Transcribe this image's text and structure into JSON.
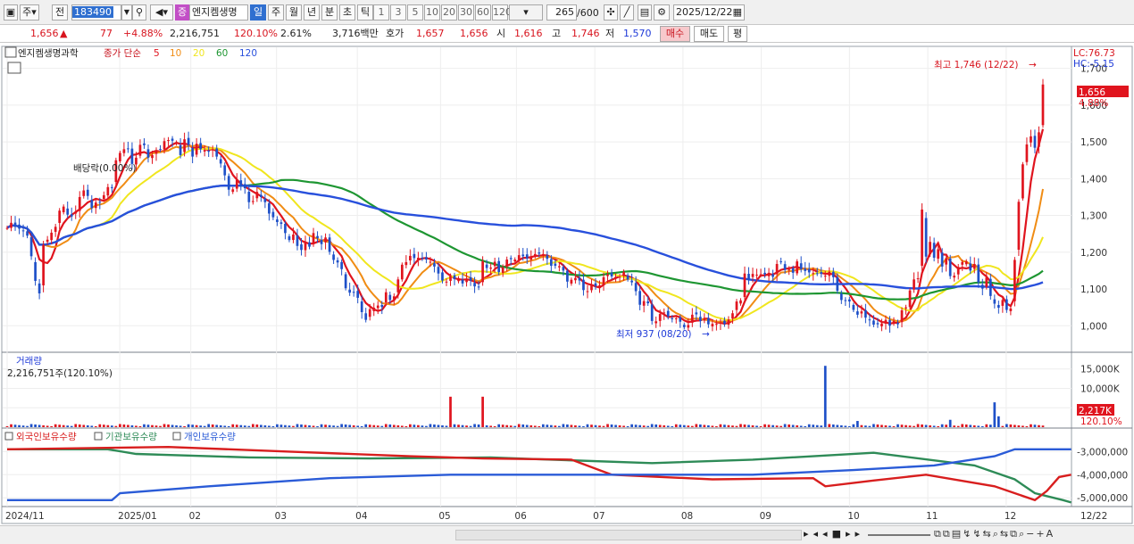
{
  "toolbar": {
    "period_label": "주",
    "prev_label": "전",
    "stock_code": "183490",
    "stock_name": "엔지켐생명",
    "name_badge": "증",
    "periods": [
      "일",
      "주",
      "월",
      "년",
      "분",
      "초",
      "틱"
    ],
    "active_period": "일",
    "intervals": [
      "1",
      "3",
      "5",
      "10",
      "20",
      "30",
      "60",
      "120"
    ],
    "count": "265",
    "count_max": "/600",
    "date": "2025/12/22"
  },
  "quote": {
    "price": "1,656",
    "change": "77",
    "change_pct": "+4.88%",
    "volume": "2,216,751",
    "volume_ratio": "120.10%",
    "turnover": "2.61%",
    "amount": "3,716백만",
    "ask_label": "호가",
    "ask": "1,657",
    "bid": "1,656",
    "open_label": "시",
    "open": "1,616",
    "high_label": "고",
    "high": "1,746",
    "low_label": "저",
    "low": "1,570",
    "buy_label": "매수",
    "sell_label": "매도",
    "eval_label": "평"
  },
  "price_panel": {
    "title": "엔지켐생명과학",
    "ma_label": "종가 단순",
    "ma_periods": [
      "5",
      "10",
      "20",
      "60",
      "120"
    ],
    "lc": "LC:76.73",
    "hc": "HC:-5.15",
    "y_labels": [
      "1,700",
      "1,600",
      "1,500",
      "1,400",
      "1,300",
      "1,200",
      "1,100",
      "1,000"
    ],
    "current_price": "1,656",
    "current_pct": "4.88%",
    "high_annot": "최고 1,746 (12/22)",
    "low_annot": "최저 937 (08/20)",
    "div_annot": "배당락(0.00%)"
  },
  "volume_panel": {
    "title": "거래량",
    "value": "2,216,751주(120.10%)",
    "y_labels": [
      "15,000K",
      "10,000K",
      "5,000K"
    ],
    "current": "2,217K",
    "current_pct": "120.10%"
  },
  "holdings_panel": {
    "legend": [
      "외국인보유수량",
      "기관보유수량",
      "개인보유수량"
    ],
    "y_labels": [
      "-3,000,000",
      "-4,000,000",
      "-5,000,000"
    ]
  },
  "x_labels": [
    "2024/11",
    "2025/01",
    "02",
    "03",
    "04",
    "05",
    "06",
    "07",
    "08",
    "09",
    "10",
    "11",
    "12",
    "12/22"
  ],
  "colors": {
    "up": "#e0141e",
    "down": "#1e50c8",
    "ma5": "#e0141e",
    "ma10": "#f08c14",
    "ma20": "#f0e61e",
    "ma60": "#1e9632",
    "ma120": "#2850dc",
    "foreign": "#d81e1e",
    "institution": "#2e8b57",
    "individual": "#2a5bd7"
  },
  "chart_data": {
    "type": "candlestick",
    "title": "엔지켐생명과학",
    "y_range": [
      940,
      1750
    ],
    "close": [
      1266,
      1280,
      1270,
      1264,
      1259,
      1245,
      1189,
      1122,
      1088,
      1220,
      1234,
      1253,
      1269,
      1313,
      1324,
      1302,
      1297,
      1310,
      1350,
      1368,
      1353,
      1320,
      1335,
      1336,
      1355,
      1377,
      1376,
      1450,
      1470,
      1480,
      1482,
      1440,
      1457,
      1492,
      1491,
      1457,
      1464,
      1474,
      1480,
      1502,
      1505,
      1503,
      1498,
      1464,
      1507,
      1492,
      1460,
      1495,
      1480,
      1478,
      1475,
      1479,
      1460,
      1441,
      1409,
      1370,
      1371,
      1396,
      1380,
      1374,
      1336,
      1339,
      1364,
      1350,
      1336,
      1305,
      1295,
      1282,
      1277,
      1252,
      1233,
      1248,
      1217,
      1206,
      1229,
      1215,
      1252,
      1238,
      1222,
      1240,
      1201,
      1179,
      1172,
      1154,
      1102,
      1090,
      1091,
      1076,
      1037,
      1016,
      1045,
      1049,
      1055,
      1051,
      1091,
      1070,
      1080,
      1126,
      1166,
      1173,
      1190,
      1184,
      1185,
      1183,
      1180,
      1174,
      1161,
      1142,
      1123,
      1120,
      1134,
      1127,
      1129,
      1115,
      1126,
      1123,
      1107,
      1104,
      1175,
      1157,
      1158,
      1174,
      1146,
      1158,
      1180,
      1181,
      1180,
      1192,
      1189,
      1183,
      1189,
      1195,
      1196,
      1195,
      1182,
      1163,
      1163,
      1162,
      1150,
      1120,
      1125,
      1130,
      1123,
      1097,
      1094,
      1112,
      1108,
      1110,
      1132,
      1139,
      1134,
      1133,
      1133,
      1146,
      1126,
      1118,
      1094,
      1057,
      1067,
      1061,
      1013,
      1012,
      1032,
      1036,
      1025,
      1020,
      1020,
      1011,
      996,
      1002,
      1030,
      1031,
      1013,
      1019,
      1004,
      1005,
      1005,
      1008,
      1005,
      1017,
      1034,
      1066,
      1069,
      1142,
      1124,
      1141,
      1139,
      1140,
      1140,
      1144,
      1133,
      1168,
      1175,
      1152,
      1154,
      1144,
      1175,
      1154,
      1149,
      1145,
      1143,
      1142,
      1141,
      1136,
      1147,
      1132,
      1095,
      1070,
      1068,
      1066,
      1043,
      1030,
      1039,
      1022,
      1016,
      1003,
      1004,
      1006,
      1016,
      1000,
      1013,
      1004,
      1042,
      1050,
      1096,
      1126,
      1129,
      1316,
      1188,
      1228,
      1185,
      1208,
      1161,
      1184,
      1135,
      1136,
      1160,
      1173,
      1175,
      1150,
      1168,
      1118,
      1101,
      1131,
      1081,
      1060,
      1049,
      1070,
      1043,
      1047,
      1179,
      1337,
      1439,
      1493,
      1515,
      1484,
      1526,
      1656
    ],
    "open_high_low": "daily OHLC per candle (265 sessions), high 1,746 (12/22), low 937 (08/20)",
    "ma": {
      "periods": [
        5,
        10,
        20,
        60,
        120
      ]
    },
    "volume_unit": "K",
    "volume": [
      100,
      100,
      100,
      100,
      100,
      100,
      100,
      100,
      100,
      100,
      100,
      100,
      100,
      100,
      100,
      100,
      100,
      100,
      100,
      100,
      100,
      100,
      100,
      100,
      100,
      100,
      100,
      100,
      100,
      100,
      100,
      100,
      100,
      100,
      100,
      100,
      100,
      100,
      100,
      100,
      100,
      100,
      100,
      100,
      100,
      100,
      100,
      100,
      100,
      100,
      100,
      100,
      100,
      100,
      100,
      100,
      100,
      100,
      100,
      100,
      100,
      100,
      100,
      100,
      100,
      100,
      100,
      100,
      100,
      100,
      100,
      100,
      100,
      100,
      100,
      100,
      100,
      100,
      100,
      100,
      100,
      100,
      100,
      100,
      100,
      100,
      100,
      100,
      100,
      100,
      100,
      100,
      100,
      100,
      100,
      100,
      100,
      100,
      100,
      100,
      100,
      100,
      100,
      100,
      100,
      100,
      100,
      100,
      100,
      100,
      100,
      100,
      100,
      100,
      100,
      100,
      100,
      100,
      7850,
      100,
      100,
      100,
      100,
      100,
      100,
      100,
      100,
      100,
      100,
      100,
      100,
      100,
      100,
      100,
      100,
      100,
      100,
      100,
      100,
      100,
      100,
      100,
      100,
      100,
      100,
      100,
      100,
      100,
      100,
      100,
      100,
      100,
      100,
      100,
      100,
      100,
      100,
      100,
      100,
      100,
      100,
      100,
      100,
      100,
      100,
      100,
      100,
      100,
      100,
      100,
      100,
      100,
      100,
      100,
      100,
      100,
      100,
      100,
      100,
      100,
      100,
      100,
      100,
      100,
      100,
      100,
      100,
      100,
      100,
      100,
      100,
      100,
      100,
      100,
      100,
      100,
      100,
      100,
      100,
      100,
      100,
      100,
      100,
      100,
      100,
      100,
      100,
      100,
      100,
      100,
      100,
      100,
      100,
      100,
      100,
      100,
      100,
      100,
      100,
      100,
      100,
      100,
      100,
      100,
      100,
      100,
      100,
      100,
      100,
      100,
      100,
      100,
      100,
      100,
      100,
      100,
      100,
      100,
      100,
      100,
      100,
      100,
      100,
      100,
      100,
      100,
      100,
      100,
      100,
      100,
      100,
      100,
      100,
      100,
      100,
      100,
      100,
      100,
      100,
      100,
      100,
      100,
      100,
      100,
      100,
      100,
      100,
      100,
      100,
      100,
      100,
      100,
      100,
      100,
      100,
      100,
      100,
      100,
      100,
      100,
      100,
      100,
      100,
      100,
      100,
      2217
    ]
  }
}
